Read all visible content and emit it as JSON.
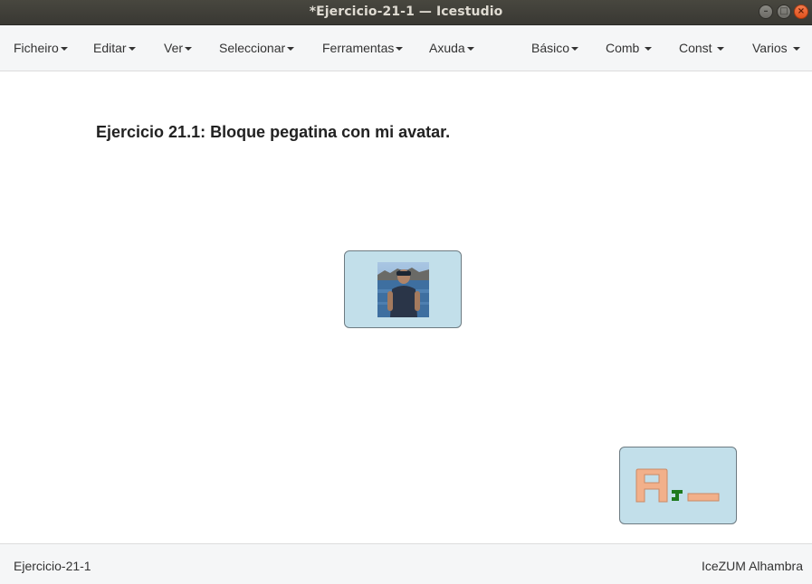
{
  "window": {
    "title": "*Ejercicio-21-1 — Icestudio",
    "controls": [
      "minimize-icon",
      "maximize-icon",
      "close-icon"
    ]
  },
  "menubar": {
    "left": [
      "Ficheiro",
      "Editar",
      "Ver",
      "Seleccionar",
      "Ferramentas",
      "Axuda"
    ],
    "right": [
      "Básico",
      "Comb",
      "Const",
      "Varios"
    ]
  },
  "canvas": {
    "heading_bold": "Ejercicio 21.1",
    "heading_rest": ": Bloque pegatina con mi avatar.",
    "blocks": [
      {
        "type": "image",
        "content": "avatar photo"
      },
      {
        "type": "logo",
        "content": "AJ logo"
      }
    ]
  },
  "statusbar": {
    "project": "Ejercicio-21-1",
    "board": "IceZUM Alhambra"
  },
  "colors": {
    "titlebar": "#3f3e39",
    "menubar": "#f5f6f7",
    "block_fill": "#c2dfea",
    "logo_orange": "#f2b08a",
    "logo_green": "#1e7a1e"
  }
}
